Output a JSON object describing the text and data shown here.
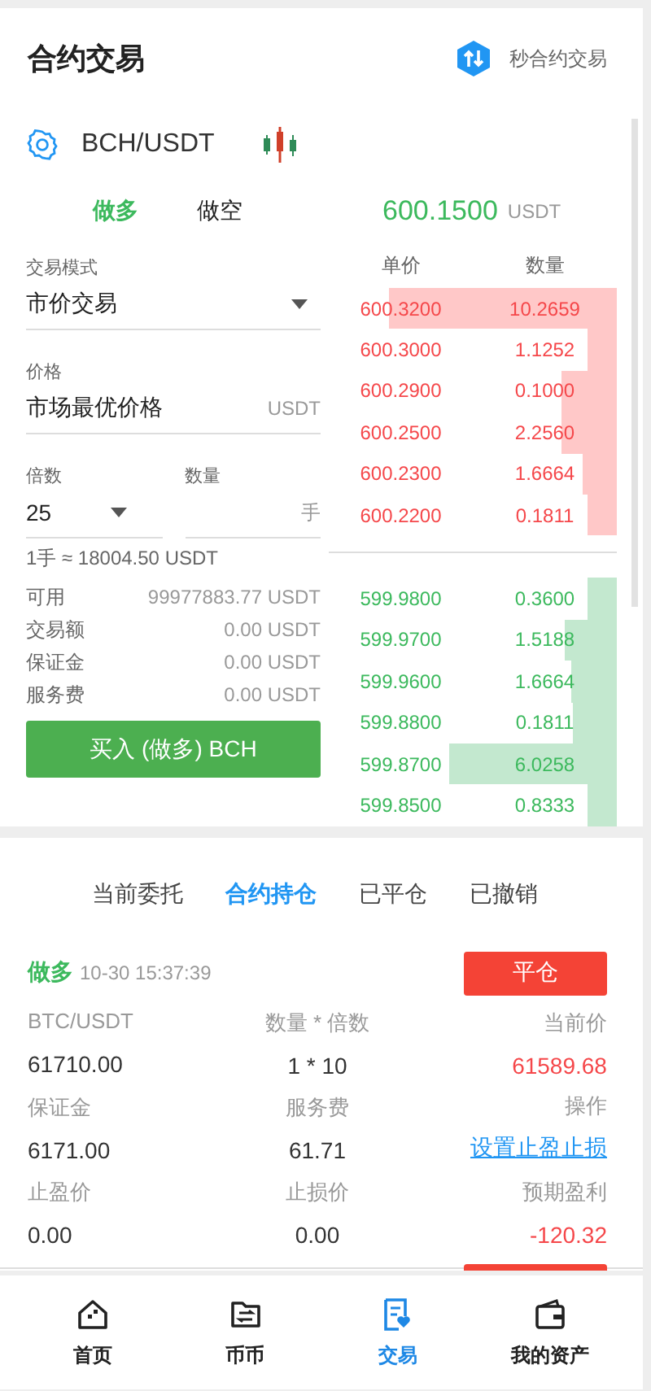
{
  "header": {
    "title": "合约交易",
    "quick_link": "秒合约交易"
  },
  "pair": {
    "symbol": "BCH/USDT"
  },
  "side_tabs": [
    {
      "label": "做多",
      "selected": true
    },
    {
      "label": "做空",
      "selected": false
    }
  ],
  "last_price": {
    "value": "600.1500",
    "unit": "USDT"
  },
  "form": {
    "mode_label": "交易模式",
    "mode_value": "市价交易",
    "price_label": "价格",
    "price_value": "市场最优价格",
    "price_unit": "USDT",
    "leverage_label": "倍数",
    "leverage_value": "25",
    "quantity_label": "数量",
    "quantity_unit": "手",
    "lot_note": "1手 ≈ 18004.50 USDT",
    "summary": [
      {
        "label": "可用",
        "value": "99977883.77 USDT"
      },
      {
        "label": "交易额",
        "value": "0.00 USDT"
      },
      {
        "label": "保证金",
        "value": "0.00 USDT"
      },
      {
        "label": "服务费",
        "value": "0.00 USDT"
      }
    ],
    "submit": "买入 (做多) BCH"
  },
  "order_book": {
    "columns": [
      "单价",
      "数量"
    ],
    "asks": [
      {
        "price": "600.3200",
        "amount": "10.2659"
      },
      {
        "price": "600.3000",
        "amount": "1.1252"
      },
      {
        "price": "600.2900",
        "amount": "0.1000"
      },
      {
        "price": "600.2500",
        "amount": "2.2560"
      },
      {
        "price": "600.2300",
        "amount": "1.6664"
      },
      {
        "price": "600.2200",
        "amount": "0.1811"
      }
    ],
    "bids": [
      {
        "price": "599.9800",
        "amount": "0.3600"
      },
      {
        "price": "599.9700",
        "amount": "1.5188"
      },
      {
        "price": "599.9600",
        "amount": "1.6664"
      },
      {
        "price": "599.8800",
        "amount": "0.1811"
      },
      {
        "price": "599.8700",
        "amount": "6.0258"
      },
      {
        "price": "599.8500",
        "amount": "0.8333"
      }
    ]
  },
  "order_tabs": [
    {
      "label": "当前委托",
      "selected": false
    },
    {
      "label": "合约持仓",
      "selected": true
    },
    {
      "label": "已平仓",
      "selected": false
    },
    {
      "label": "已撤销",
      "selected": false
    }
  ],
  "positions": [
    {
      "side": "做多",
      "color": "#3cb95d",
      "time": "10-30 15:37:39",
      "close_button": "平仓",
      "fields": [
        {
          "label": "BTC/USDT",
          "value": "61710.00",
          "kind": "plain"
        },
        {
          "label": "数量 * 倍数",
          "value": "1 * 10",
          "kind": "plain"
        },
        {
          "label": "当前价",
          "value": "61589.68",
          "kind": "down"
        },
        {
          "label": "保证金",
          "value": "6171.00",
          "kind": "plain"
        },
        {
          "label": "服务费",
          "value": "61.71",
          "kind": "plain"
        },
        {
          "label": "操作",
          "value": "设置止盈止损",
          "kind": "link"
        },
        {
          "label": "止盈价",
          "value": "0.00",
          "kind": "plain"
        },
        {
          "label": "止损价",
          "value": "0.00",
          "kind": "plain"
        },
        {
          "label": "预期盈利",
          "value": "-120.32",
          "kind": "down"
        }
      ]
    }
  ],
  "bottom_nav": [
    {
      "label": "首页",
      "selected": false
    },
    {
      "label": "币币",
      "selected": false
    },
    {
      "label": "交易",
      "selected": true
    },
    {
      "label": "我的资产",
      "selected": false
    }
  ]
}
